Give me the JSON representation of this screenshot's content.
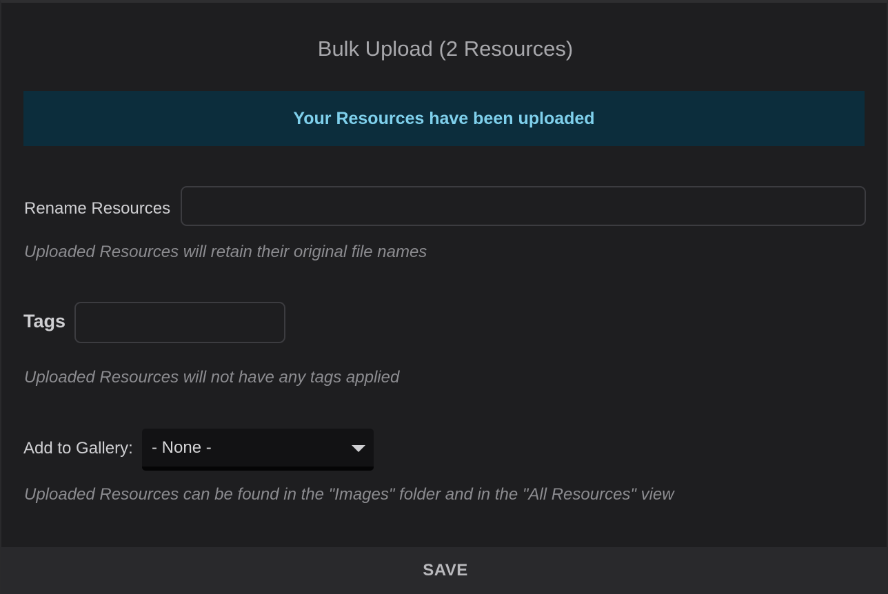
{
  "dialog": {
    "title": "Bulk Upload (2 Resources)"
  },
  "banner": {
    "message": "Your Resources have been uploaded"
  },
  "rename": {
    "label": "Rename Resources",
    "value": "",
    "placeholder": "",
    "help": "Uploaded Resources will retain their original file names"
  },
  "tags": {
    "label": "Tags",
    "value": "",
    "placeholder": "",
    "help": "Uploaded Resources will not have any tags applied"
  },
  "gallery": {
    "label": "Add to Gallery:",
    "selected": "- None -",
    "help": "Uploaded Resources can be found in the \"Images\" folder and in the \"All Resources\" view"
  },
  "footer": {
    "save_label": "SAVE"
  },
  "colors": {
    "background": "#1e1e20",
    "banner_bg": "#0c2d3c",
    "banner_text": "#7fd0ec",
    "footer_bg": "#29292c"
  },
  "icons": {
    "select_caret": "caret-down-icon"
  }
}
